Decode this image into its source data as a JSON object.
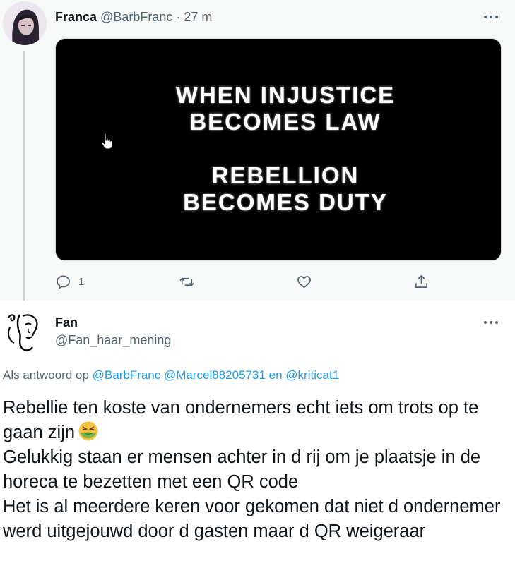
{
  "parent": {
    "name": "Franca",
    "handle": "@BarbFranc",
    "separator": "·",
    "time": "27 m",
    "media_lines": [
      "WHEN INJUSTICE",
      "BECOMES LAW",
      "REBELLION",
      "BECOMES DUTY"
    ],
    "actions": {
      "reply_count": "1",
      "retweet_count": "",
      "like_count": ""
    }
  },
  "reply": {
    "name": "Fan",
    "handle": "@Fan_haar_mening",
    "reply_to_prefix": "Als antwoord op",
    "mentions": [
      "@BarbFranc",
      "@Marcel88205731"
    ],
    "reply_to_joiner": "en",
    "last_mention": "@kriticat1",
    "body_lines": [
      "Rebellie ten koste van ondernemers  echt iets om trots op te gaan zijn",
      "Gelukkig staan er mensen achter in d rij om je plaatsje in de horeca te bezetten met een QR code",
      "Het is al meerdere keren voor gekomen dat niet d ondernemer werd uitgejouwd door d gasten maar d QR weigeraar"
    ],
    "emoji": "nauseated-face-emoji"
  },
  "colors": {
    "accent": "#1d9bf0",
    "secondary_text": "#536471",
    "parent_background": "#f7f9f9",
    "thread_line": "#c4cfd6"
  }
}
